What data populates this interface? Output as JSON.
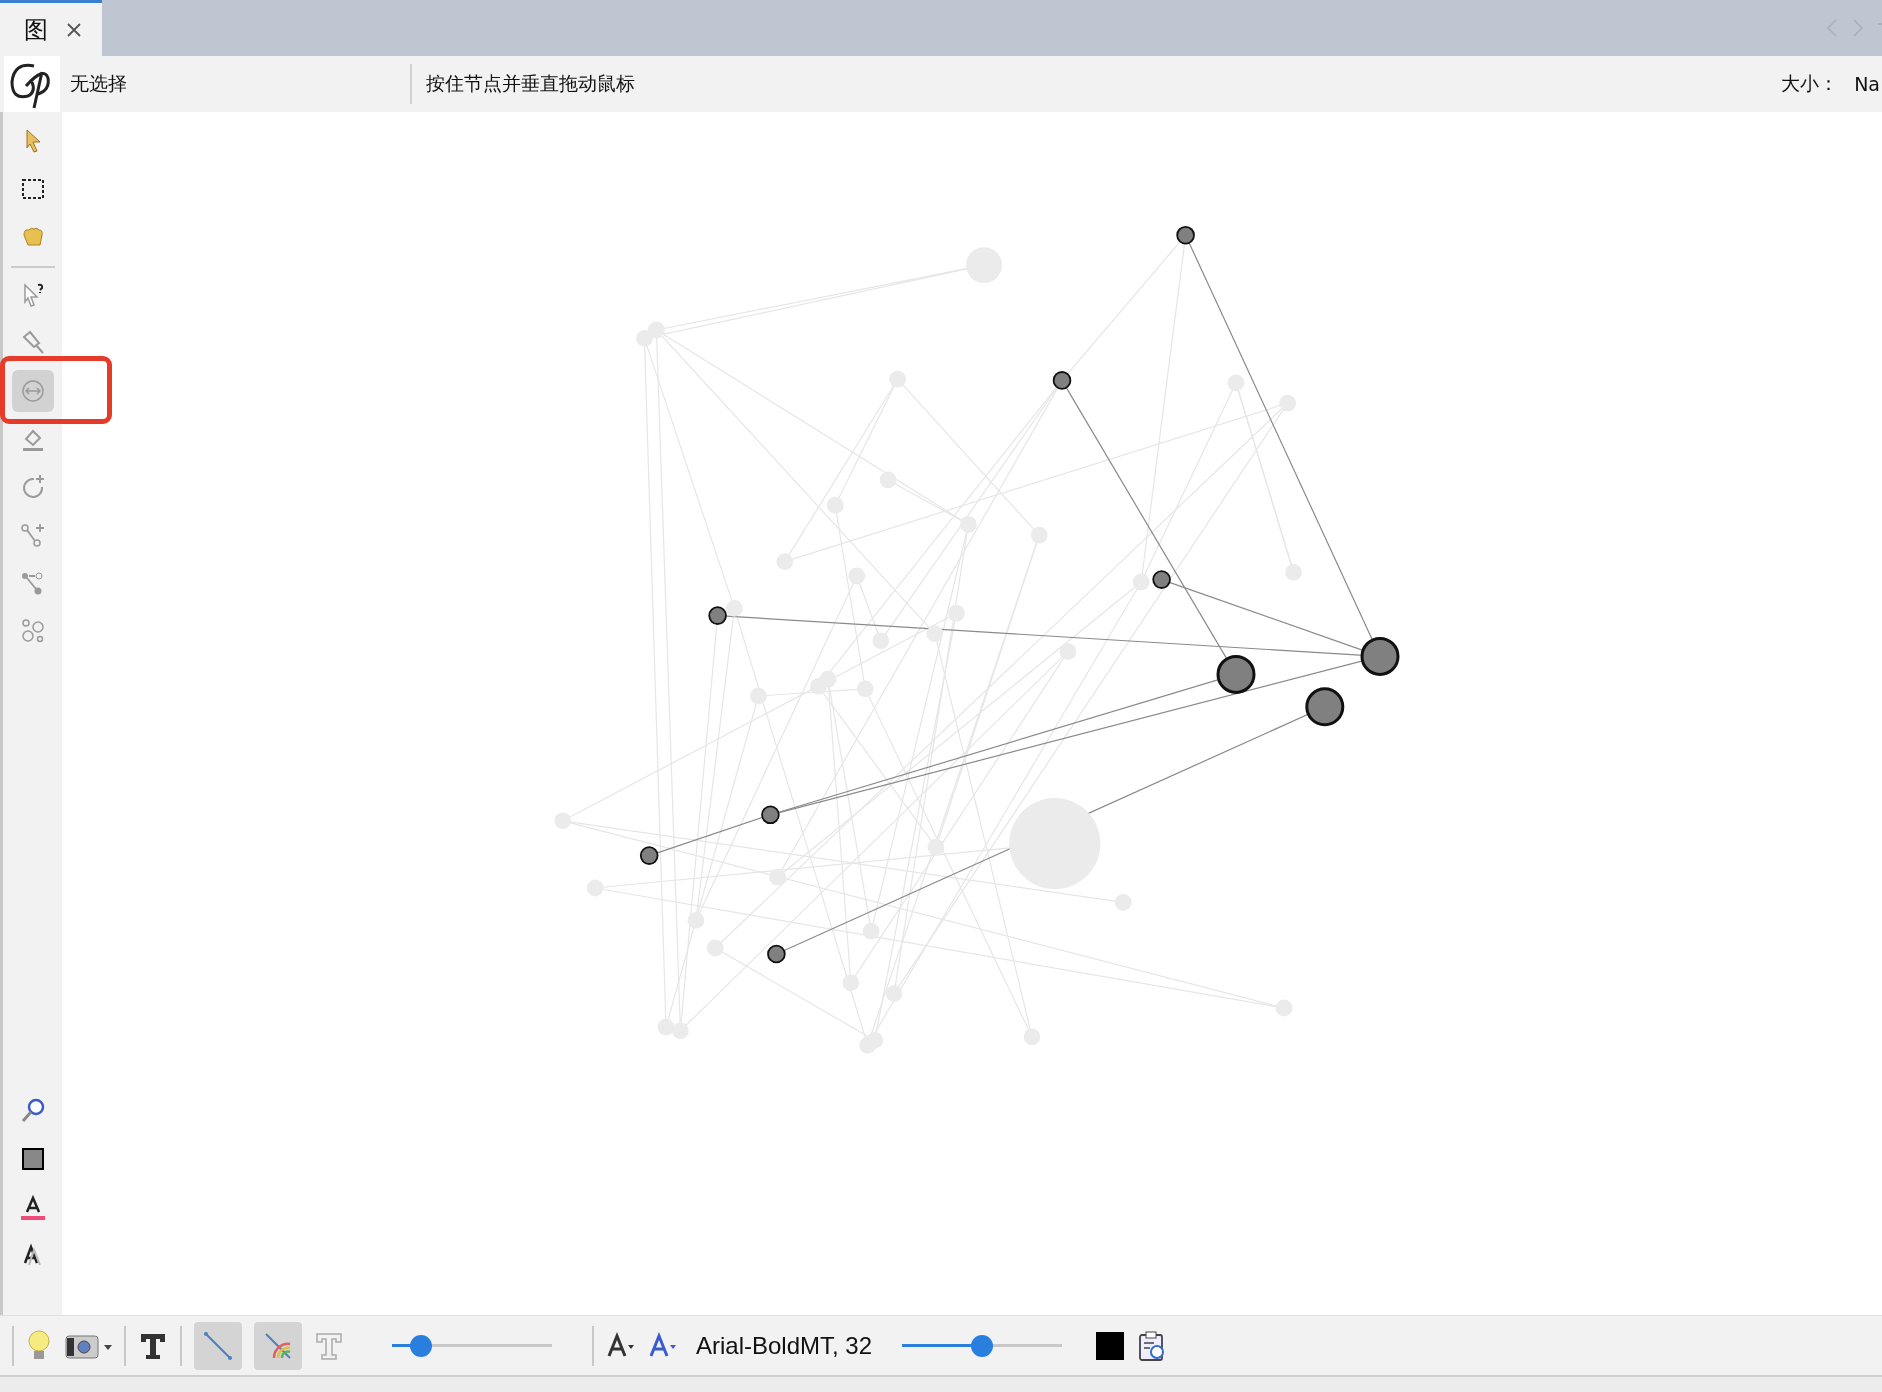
{
  "tab": {
    "label": "图",
    "selected": true
  },
  "header": {
    "selection": "无选择",
    "hint": "按住节点并垂直拖动鼠标",
    "size_label": "大小：",
    "size_value": "Na"
  },
  "left_tools": [
    {
      "selected": false
    },
    {
      "selected": false
    },
    {
      "selected": false
    },
    {
      "selected": false
    },
    {
      "selected": false
    },
    {
      "selected": true
    },
    {
      "selected": false
    },
    {
      "selected": false
    },
    {
      "selected": false
    },
    {
      "selected": false
    },
    {
      "selected": false
    }
  ],
  "bottom_toolbar": {
    "edge_toggles": [
      {
        "selected": true
      },
      {
        "selected": true
      }
    ],
    "edge_slider": {
      "level": 0.18
    },
    "font": "Arial-BoldMT, 32",
    "label_slider": {
      "level": 0.5
    }
  }
}
